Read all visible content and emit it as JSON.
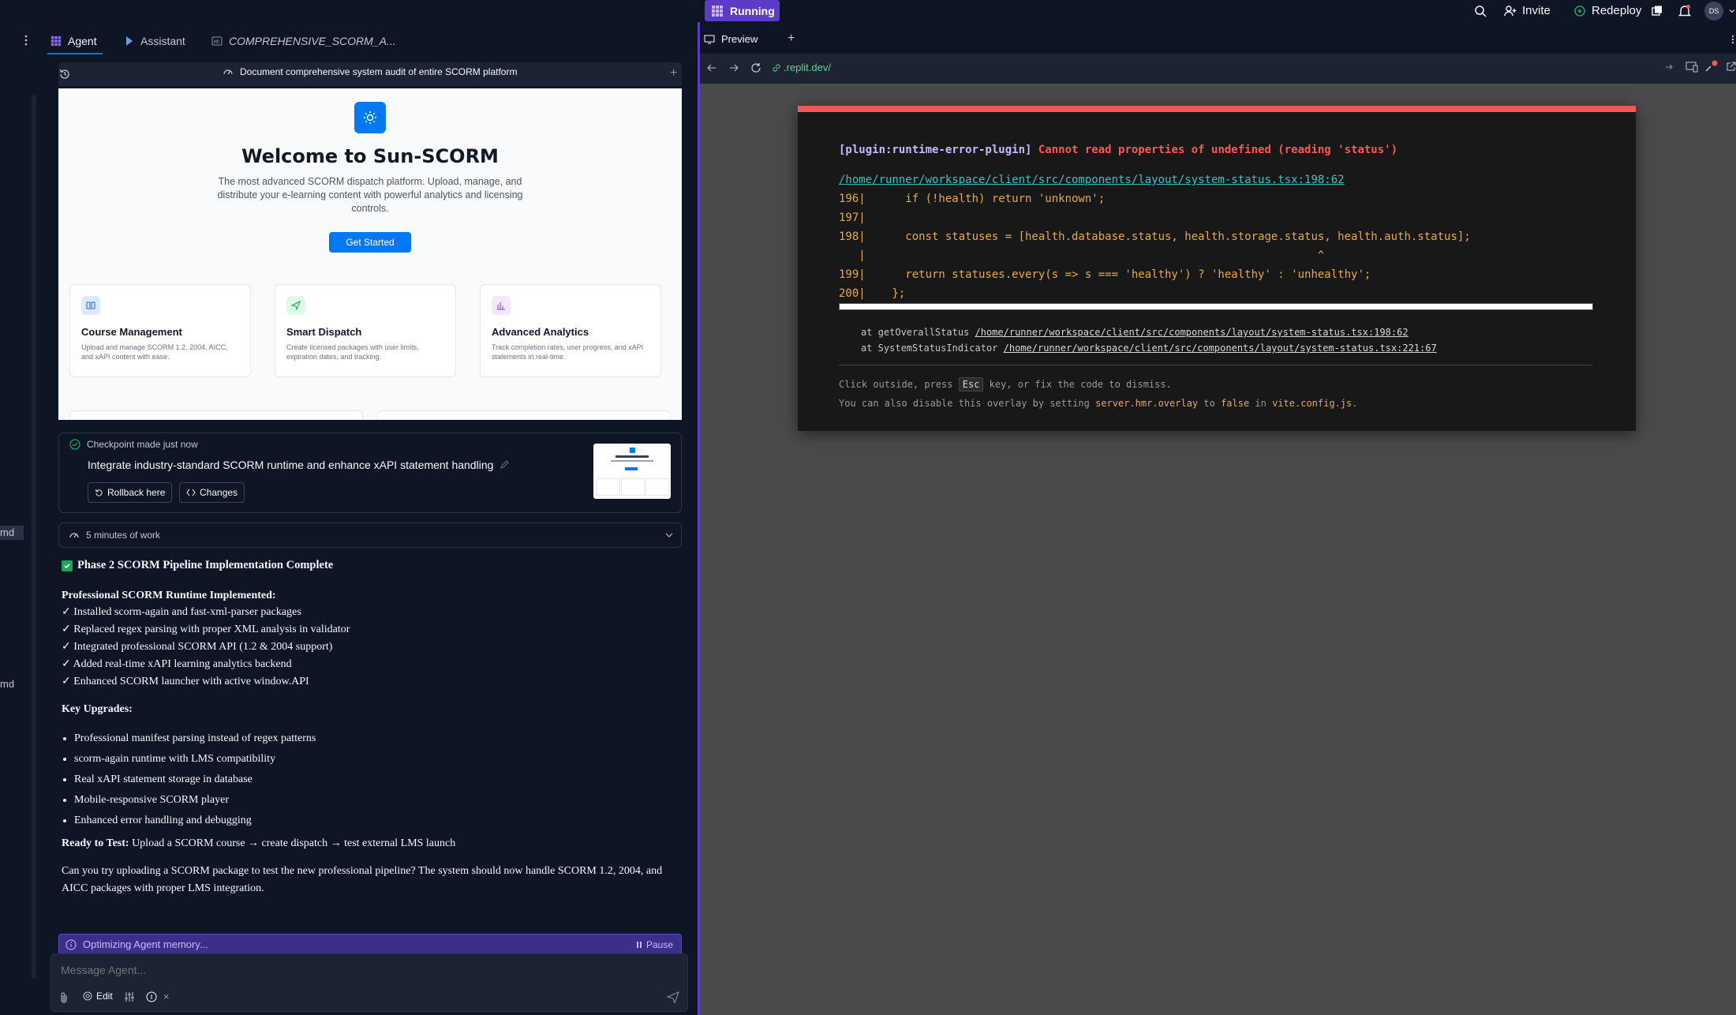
{
  "topbar": {
    "status": "Running",
    "invite_label": "Invite",
    "redeploy_label": "Redeploy",
    "avatar_initials": "DS"
  },
  "left_strip": {
    "item1": "md",
    "item2": "md"
  },
  "agent_tabs": [
    {
      "label": "Agent"
    },
    {
      "label": "Assistant"
    },
    {
      "label": "COMPREHENSIVE_SCORM_A..."
    }
  ],
  "history": {
    "title": "Document comprehensive system audit of entire SCORM platform"
  },
  "app_preview": {
    "heading": "Welcome to Sun-SCORM",
    "subtitle": "The most advanced SCORM dispatch platform. Upload, manage, and distribute your e-learning content with powerful analytics and licensing controls.",
    "cta": "Get Started",
    "features": [
      {
        "title": "Course Management",
        "desc": "Upload and manage SCORM 1.2, 2004, AICC, and xAPI content with ease."
      },
      {
        "title": "Smart Dispatch",
        "desc": "Create licensed packages with user limits, expiration dates, and tracking."
      },
      {
        "title": "Advanced Analytics",
        "desc": "Track completion rates, user progress, and xAPI statements in real-time."
      }
    ]
  },
  "checkpoint": {
    "status": "Checkpoint made just now",
    "title": "Integrate industry-standard SCORM runtime and enhance xAPI statement handling",
    "rollback_label": "Rollback here",
    "changes_label": "Changes"
  },
  "work": {
    "label": "5 minutes of work"
  },
  "message": {
    "heading": "Phase 2 SCORM Pipeline Implementation Complete",
    "runtime_heading": "Professional SCORM Runtime Implemented:",
    "checks": [
      "✓ Installed scorm-again and fast-xml-parser packages",
      "✓ Replaced regex parsing with proper XML analysis in validator",
      "✓ Integrated professional SCORM API (1.2 & 2004 support)",
      "✓ Added real-time xAPI learning analytics backend",
      "✓ Enhanced SCORM launcher with active window.API"
    ],
    "upgrades_heading": "Key Upgrades:",
    "upgrades": [
      "Professional manifest parsing instead of regex patterns",
      "scorm-again runtime with LMS compatibility",
      "Real xAPI statement storage in database",
      "Mobile-responsive SCORM player",
      "Enhanced error handling and debugging"
    ],
    "ready_label": "Ready to Test:",
    "ready_text": " Upload a SCORM course → create dispatch → test external LMS launch",
    "question": "Can you try uploading a SCORM package to test the new professional pipeline? The system should now handle SCORM 1.2, 2004, and AICC packages with proper LMS integration."
  },
  "optimizing": {
    "label": "Optimizing Agent memory...",
    "pause_label": "Pause"
  },
  "input": {
    "placeholder": "Message Agent...",
    "edit_label": "Edit"
  },
  "preview": {
    "tab_label": "Preview",
    "url": ".replit.dev/"
  },
  "error": {
    "plugin": "[plugin:runtime-error-plugin]",
    "message": "Cannot read properties of undefined (reading 'status')",
    "file_link": "/home/runner/workspace/client/src/components/layout/system-status.tsx:198:62",
    "code_lines": [
      "196|      if (!health) return 'unknown';",
      "197|",
      "198|      const statuses = [health.database.status, health.storage.status, health.auth.status];",
      "   |                                                                    ^",
      "199|      return statuses.every(s => s === 'healthy') ? 'healthy' : 'unhealthy';",
      "200|    };"
    ],
    "stack1_prefix": "at getOverallStatus ",
    "stack1_link": "/home/runner/workspace/client/src/components/layout/system-status.tsx:198:62",
    "stack2_prefix": "at SystemStatusIndicator ",
    "stack2_link": "/home/runner/workspace/client/src/components/layout/system-status.tsx:221:67",
    "tip1_a": "Click outside, press ",
    "tip1_key": "Esc",
    "tip1_b": " key, or fix the code to dismiss.",
    "tip2_a": "You can also disable this overlay by setting ",
    "tip2_setting": "server.hmr.overlay",
    "tip2_b": " to ",
    "tip2_false": "false",
    "tip2_c": " in ",
    "tip2_file": "vite.config.js",
    "tip2_d": "."
  },
  "colors": {
    "accent": "#5b3cc4",
    "error_red": "#ff5555",
    "code_orange": "#e8a948",
    "link_teal": "#2dc7c5",
    "primary_blue": "#0079f2"
  }
}
